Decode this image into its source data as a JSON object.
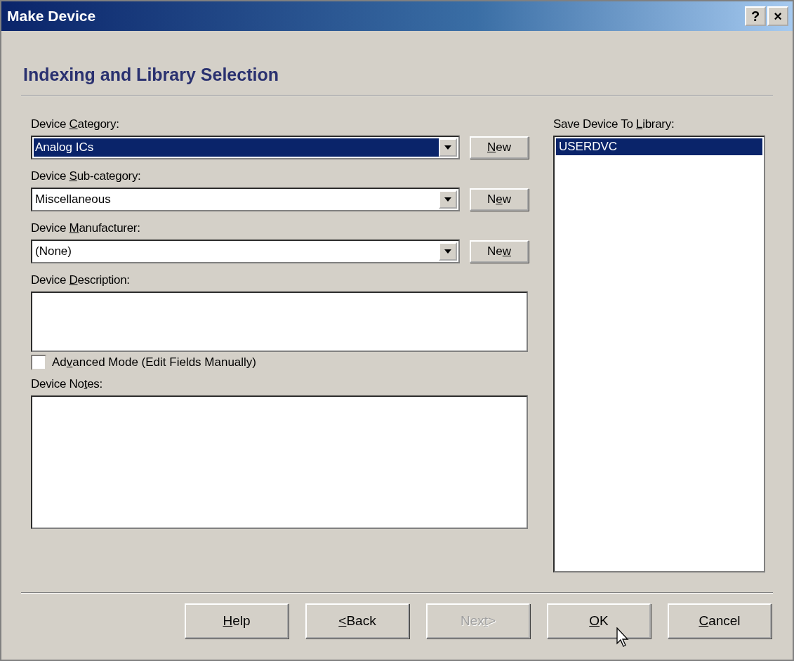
{
  "window": {
    "title": "Make Device",
    "help_glyph": "?",
    "close_glyph": "×"
  },
  "heading": "Indexing and Library Selection",
  "combos": [
    {
      "label": {
        "pre": "Device ",
        "key": "C",
        "post": "ategory:"
      },
      "value": "Analog ICs",
      "focused": true,
      "new_button": {
        "key": "N",
        "post": "ew"
      }
    },
    {
      "label": {
        "pre": "Device ",
        "key": "S",
        "post": "ub-category:"
      },
      "value": "Miscellaneous",
      "focused": false,
      "new_button": {
        "pre": "N",
        "key": "e",
        "post": "w"
      }
    },
    {
      "label": {
        "pre": "Device ",
        "key": "M",
        "post": "anufacturer:"
      },
      "value": "(None)",
      "focused": false,
      "new_button": {
        "pre": "Ne",
        "key": "w"
      }
    }
  ],
  "description": {
    "label": {
      "pre": "Device ",
      "key": "D",
      "post": "escription:"
    }
  },
  "advanced_mode": {
    "label": {
      "pre": "Ad",
      "key": "v",
      "post": "anced Mode (Edit Fields Manually)"
    },
    "checked": false
  },
  "notes": {
    "label": {
      "pre": "Device No",
      "key": "t",
      "post": "es:"
    }
  },
  "library": {
    "label": {
      "pre": "Save Device To ",
      "key": "L",
      "post": "ibrary:"
    },
    "items": [
      {
        "text": "USERDVC",
        "selected": true
      }
    ]
  },
  "buttons": [
    {
      "label": {
        "key": "H",
        "post": "elp"
      },
      "disabled": false
    },
    {
      "label": {
        "key": "<",
        "post": "Back"
      },
      "disabled": false
    },
    {
      "label": {
        "pre": "Nex",
        "key": "t",
        "post": ">"
      },
      "disabled": true
    },
    {
      "label": {
        "key": "O",
        "post": "K"
      },
      "disabled": false
    },
    {
      "label": {
        "key": "C",
        "post": "ancel"
      },
      "disabled": false
    }
  ]
}
